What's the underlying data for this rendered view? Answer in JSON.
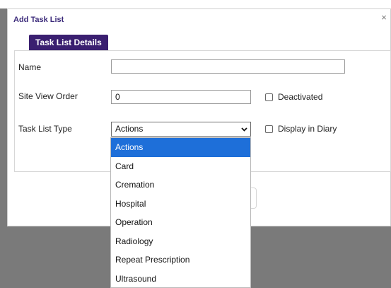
{
  "dialog": {
    "title": "Add Task List",
    "close_glyph": "×"
  },
  "tabs": [
    {
      "label": "Task List Details"
    }
  ],
  "form": {
    "name_label": "Name",
    "name_value": "",
    "site_view_order_label": "Site View Order",
    "site_view_order_value": "0",
    "deactivated_label": "Deactivated",
    "deactivated_checked": false,
    "task_list_type_label": "Task List Type",
    "task_list_type_selected": "Actions",
    "display_in_diary_label": "Display in Diary",
    "display_in_diary_checked": false
  },
  "dropdown": {
    "options": [
      "Actions",
      "Card",
      "Cremation",
      "Hospital",
      "Operation",
      "Radiology",
      "Repeat Prescription",
      "Ultrasound"
    ],
    "selected_index": 0
  },
  "icons": {
    "close": "close-icon",
    "select_chevron": "chevron-down-icon"
  },
  "colors": {
    "title": "#3b2a7a",
    "tab_bg": "#3a1f70",
    "selected_option_bg": "#1e6fd9",
    "overlay": "#7a7a7a"
  }
}
